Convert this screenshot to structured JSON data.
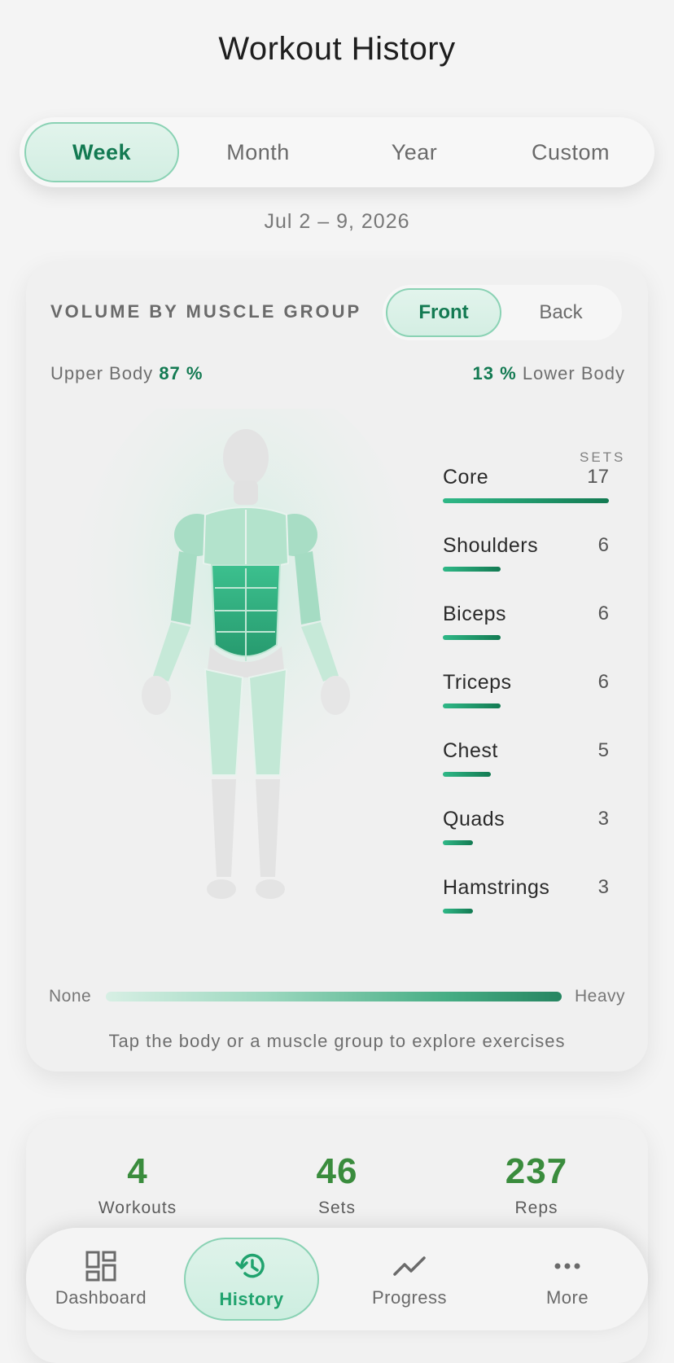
{
  "title": "Workout History",
  "period_tabs": [
    "Week",
    "Month",
    "Year",
    "Custom"
  ],
  "active_period": "Week",
  "date_range": "Jul 2 – 9, 2026",
  "volume": {
    "heading": "VOLUME BY MUSCLE GROUP",
    "view_tabs": [
      "Front",
      "Back"
    ],
    "active_view": "Front",
    "upper_label": "Upper Body",
    "upper_pct": "87 %",
    "lower_label": "Lower Body",
    "lower_pct": "13 %",
    "sets_header": "SETS",
    "groups": [
      {
        "name": "Core",
        "sets": "17",
        "fraction": 1.0
      },
      {
        "name": "Shoulders",
        "sets": "6",
        "fraction": 0.35
      },
      {
        "name": "Biceps",
        "sets": "6",
        "fraction": 0.35
      },
      {
        "name": "Triceps",
        "sets": "6",
        "fraction": 0.35
      },
      {
        "name": "Chest",
        "sets": "5",
        "fraction": 0.29
      },
      {
        "name": "Quads",
        "sets": "3",
        "fraction": 0.18
      },
      {
        "name": "Hamstrings",
        "sets": "3",
        "fraction": 0.18
      }
    ],
    "legend_min": "None",
    "legend_max": "Heavy",
    "hint": "Tap the body or a muscle group to explore exercises",
    "accent": "#137a52"
  },
  "stats": [
    {
      "value": "4",
      "label": "Workouts"
    },
    {
      "value": "46",
      "label": "Sets"
    },
    {
      "value": "237",
      "label": "Reps"
    }
  ],
  "nav": {
    "items": [
      {
        "label": "Dashboard",
        "icon": "dashboard-icon"
      },
      {
        "label": "History",
        "icon": "history-icon"
      },
      {
        "label": "Progress",
        "icon": "progress-icon"
      },
      {
        "label": "More",
        "icon": "more-icon"
      }
    ],
    "active": "History"
  }
}
